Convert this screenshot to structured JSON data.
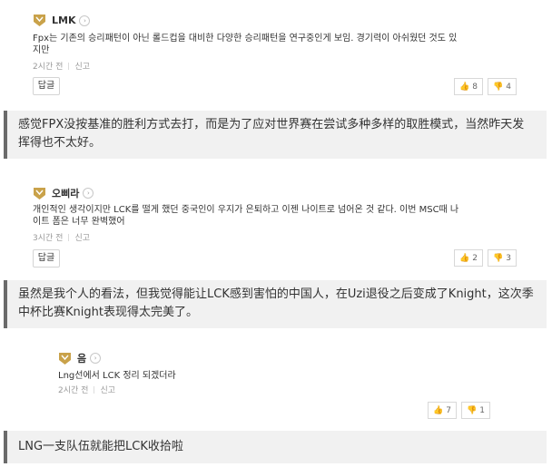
{
  "colors": {
    "badge_gold": "#c9a24a",
    "vote_icon": "#e06a3b",
    "translation_bar": "#6a6a6a"
  },
  "comments": [
    {
      "author": "LMK",
      "text": "Fpx는 기존의 승리패턴이 아닌 롤드컵을 대비한 다양한 승리패턴을 연구중인게 보임. 경기력이 아쉬웠던 것도 있\n지만",
      "time": "2시간 전",
      "report": "신고",
      "reply": "답글",
      "upvotes": "8",
      "downvotes": "4",
      "translation": "感觉FPX没按基准的胜利方式去打，而是为了应对世界赛在尝试多种多样的取胜模式，当然昨天发挥得也不太好。"
    },
    {
      "author": "오삐라",
      "text": "개인적인 생각이지만 LCK를 떨게 했던 중국인이 우지가 은퇴하고 이젠 나이트로 넘어온 것 같다. 이번 MSC때 나\n이트 폼은 너무 완벽했어",
      "time": "3시간 전",
      "report": "신고",
      "reply": "답글",
      "upvotes": "2",
      "downvotes": "3",
      "translation": "虽然是我个人的看法，但我觉得能让LCK感到害怕的中国人，在Uzi退役之后变成了Knight，这次季中杯比赛Knight表现得太完美了。"
    },
    {
      "author": "음",
      "text": "Lng선에서 LCK 정리 되겠더라",
      "time": "2시간 전",
      "report": "신고",
      "upvotes": "7",
      "downvotes": "1",
      "translation": "LNG一支队伍就能把LCK收拾啦"
    }
  ]
}
